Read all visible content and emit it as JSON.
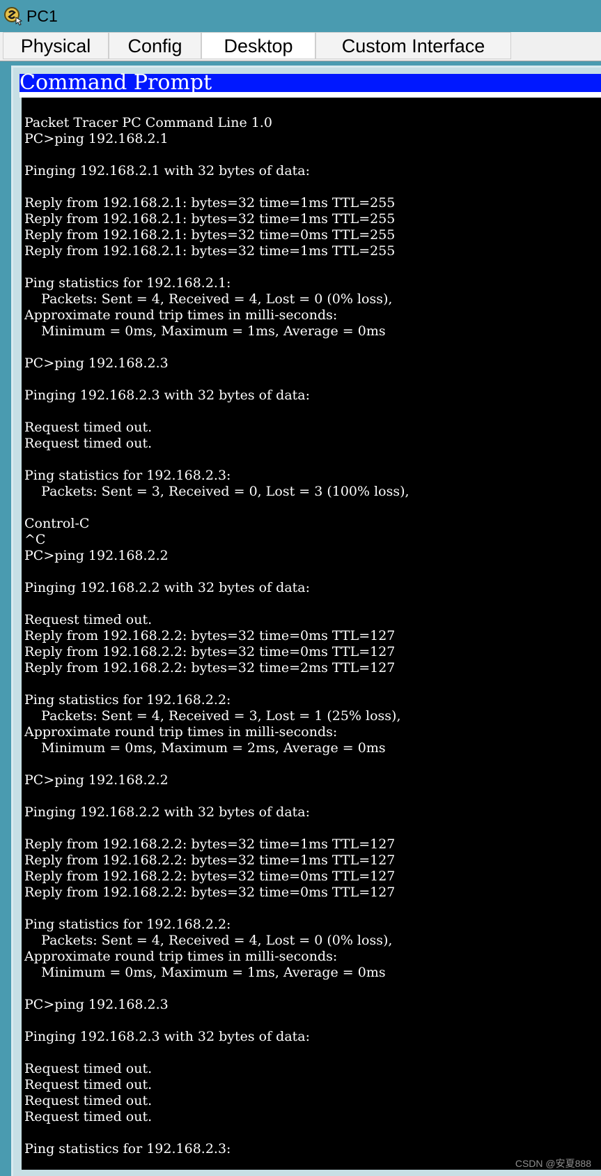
{
  "window": {
    "title": "PC1",
    "icon": "packet-tracer-pc-icon"
  },
  "tabs": [
    {
      "label": "Physical",
      "active": false
    },
    {
      "label": "Config",
      "active": false
    },
    {
      "label": "Desktop",
      "active": true
    },
    {
      "label": "Custom Interface",
      "active": false
    }
  ],
  "command_prompt": {
    "title": "Command Prompt",
    "lines": [
      "Packet Tracer PC Command Line 1.0",
      "PC>ping 192.168.2.1",
      "",
      "Pinging 192.168.2.1 with 32 bytes of data:",
      "",
      "Reply from 192.168.2.1: bytes=32 time=1ms TTL=255",
      "Reply from 192.168.2.1: bytes=32 time=1ms TTL=255",
      "Reply from 192.168.2.1: bytes=32 time=0ms TTL=255",
      "Reply from 192.168.2.1: bytes=32 time=1ms TTL=255",
      "",
      "Ping statistics for 192.168.2.1:",
      "    Packets: Sent = 4, Received = 4, Lost = 0 (0% loss),",
      "Approximate round trip times in milli-seconds:",
      "    Minimum = 0ms, Maximum = 1ms, Average = 0ms",
      "",
      "PC>ping 192.168.2.3",
      "",
      "Pinging 192.168.2.3 with 32 bytes of data:",
      "",
      "Request timed out.",
      "Request timed out.",
      "",
      "Ping statistics for 192.168.2.3:",
      "    Packets: Sent = 3, Received = 0, Lost = 3 (100% loss),",
      "",
      "Control-C",
      "^C",
      "PC>ping 192.168.2.2",
      "",
      "Pinging 192.168.2.2 with 32 bytes of data:",
      "",
      "Request timed out.",
      "Reply from 192.168.2.2: bytes=32 time=0ms TTL=127",
      "Reply from 192.168.2.2: bytes=32 time=0ms TTL=127",
      "Reply from 192.168.2.2: bytes=32 time=2ms TTL=127",
      "",
      "Ping statistics for 192.168.2.2:",
      "    Packets: Sent = 4, Received = 3, Lost = 1 (25% loss),",
      "Approximate round trip times in milli-seconds:",
      "    Minimum = 0ms, Maximum = 2ms, Average = 0ms",
      "",
      "PC>ping 192.168.2.2",
      "",
      "Pinging 192.168.2.2 with 32 bytes of data:",
      "",
      "Reply from 192.168.2.2: bytes=32 time=1ms TTL=127",
      "Reply from 192.168.2.2: bytes=32 time=1ms TTL=127",
      "Reply from 192.168.2.2: bytes=32 time=0ms TTL=127",
      "Reply from 192.168.2.2: bytes=32 time=0ms TTL=127",
      "",
      "Ping statistics for 192.168.2.2:",
      "    Packets: Sent = 4, Received = 4, Lost = 0 (0% loss),",
      "Approximate round trip times in milli-seconds:",
      "    Minimum = 0ms, Maximum = 1ms, Average = 0ms",
      "",
      "PC>ping 192.168.2.3",
      "",
      "Pinging 192.168.2.3 with 32 bytes of data:",
      "",
      "Request timed out.",
      "Request timed out.",
      "Request timed out.",
      "Request timed out.",
      "",
      "Ping statistics for 192.168.2.3:"
    ]
  },
  "watermark": "CSDN @安夏888",
  "colors": {
    "window_bg": "#4a9bb0",
    "title_bar_blue": "#0018ff",
    "console_bg": "#000000",
    "console_text": "#ffffff"
  }
}
